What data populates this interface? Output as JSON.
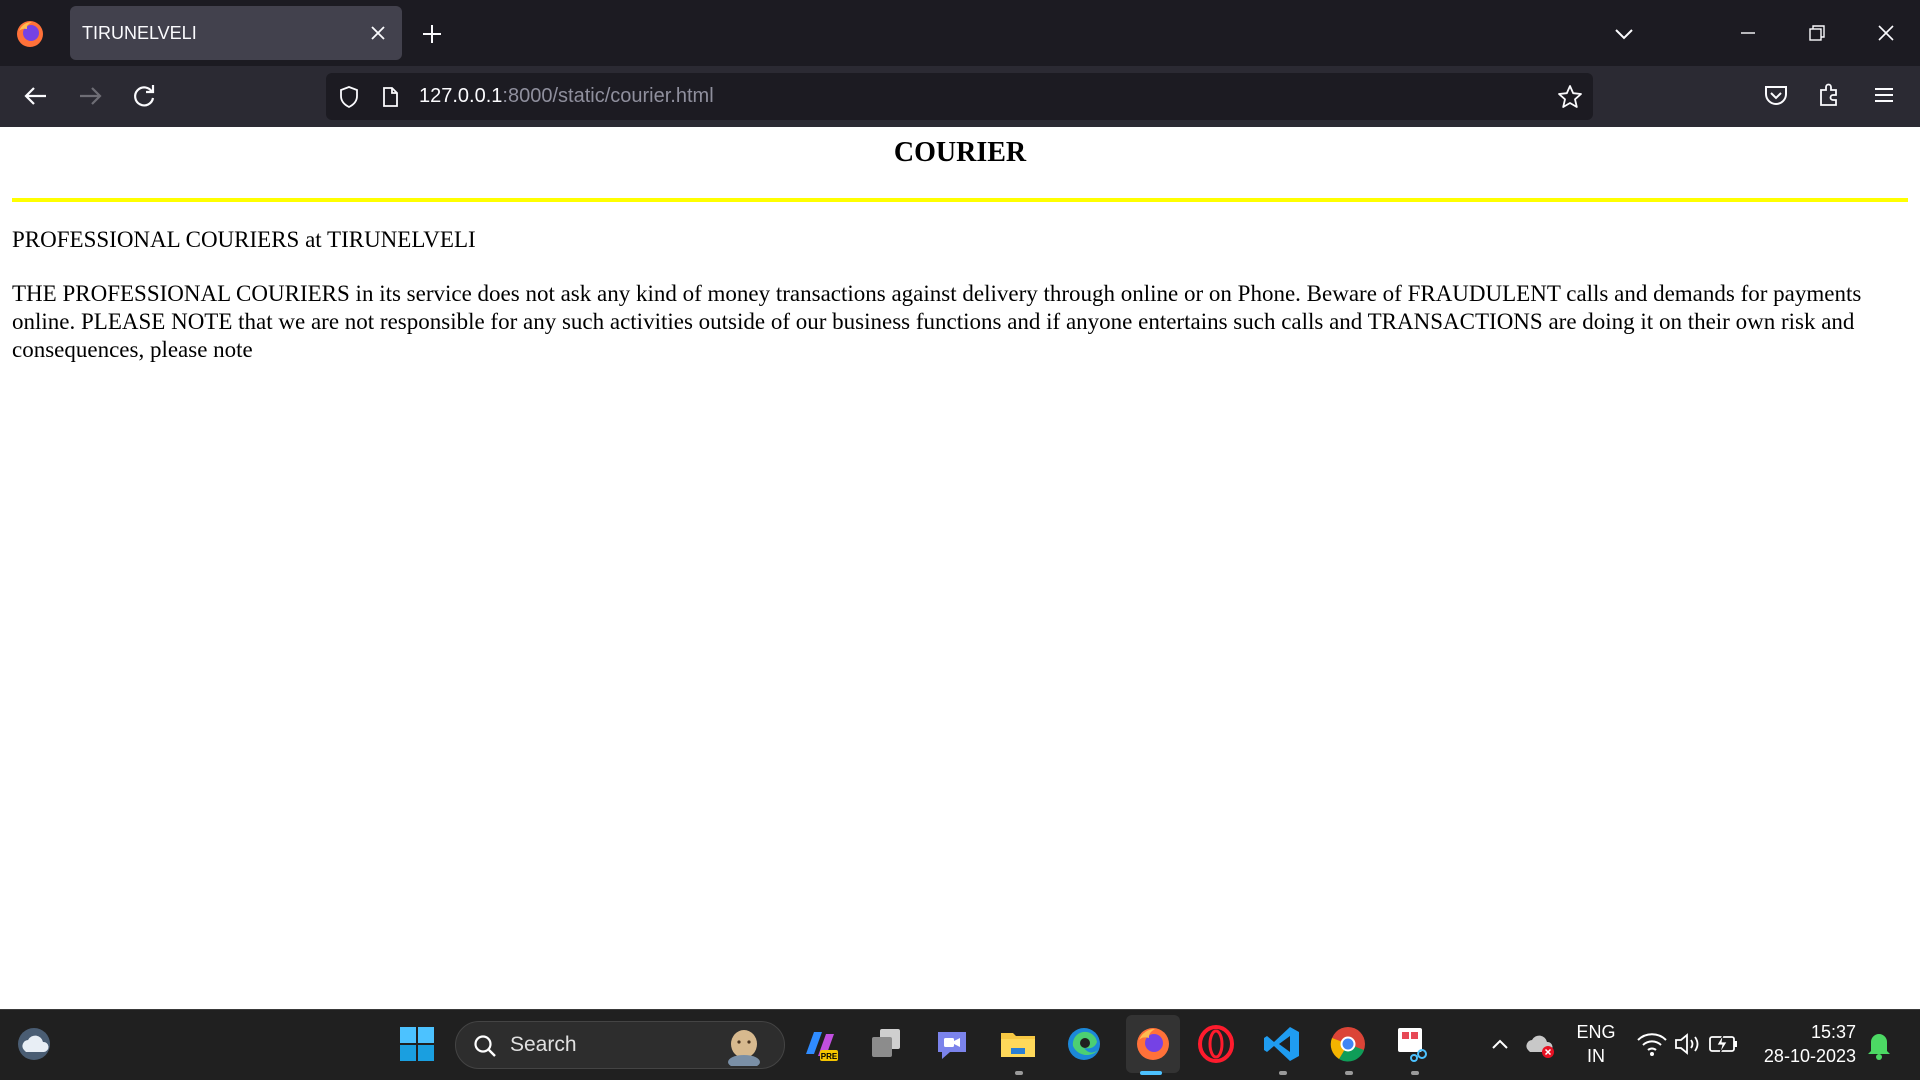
{
  "browser": {
    "tab_title": "TIRUNELVELI",
    "url_host": "127.0.0.1",
    "url_path": ":8000/static/courier.html"
  },
  "page": {
    "title": "COURIER",
    "rule_color": "#ffff00",
    "subtitle": "PROFESSIONAL COURIERS at TIRUNELVELI",
    "notice": "THE PROFESSIONAL COURIERS in its service does not ask any kind of money transactions against delivery through online or on Phone. Beware of FRAUDULENT calls and demands for payments online. PLEASE NOTE that we are not responsible for any such activities outside of our business functions and if anyone entertains such calls and TRANSACTIONS are doing it on their own risk and consequences, please note"
  },
  "taskbar": {
    "search_label": "Search",
    "language": "ENG",
    "region": "IN",
    "time": "15:37",
    "date": "28-10-2023",
    "apps": [
      "copilot-icon",
      "task-view-icon",
      "teams-chat-icon",
      "file-explorer-icon",
      "edge-icon",
      "firefox-icon",
      "opera-icon",
      "vscode-icon",
      "chrome-icon",
      "snipping-tool-icon"
    ]
  }
}
